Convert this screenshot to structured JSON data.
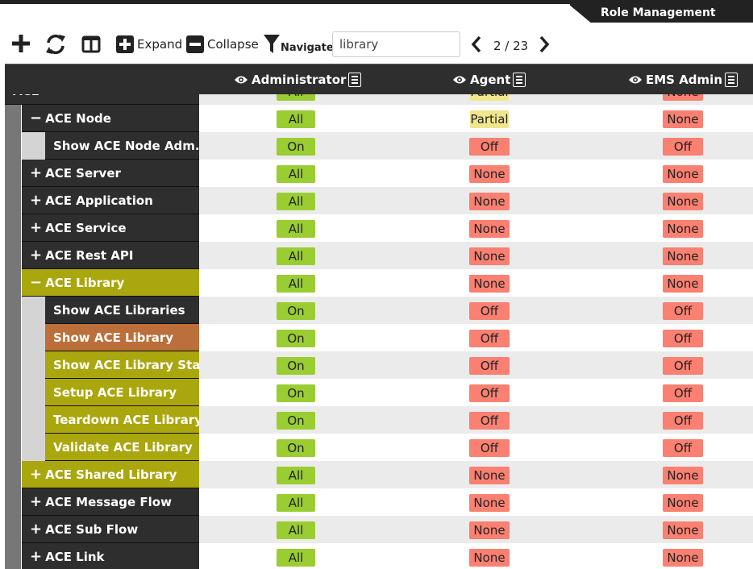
{
  "header": {
    "role_tab": "Role Management"
  },
  "toolbar": {
    "expand": "Expand",
    "collapse": "Collapse",
    "navigate": "Navigate",
    "search_value": "library",
    "page": "2 / 23"
  },
  "columns": [
    "Administrator",
    "Agent",
    "EMS Admin"
  ],
  "rows": [
    {
      "label": "ACE",
      "expander": "",
      "level": 0,
      "style": "dark",
      "values": [
        "All",
        "Partial",
        "None"
      ]
    },
    {
      "label": "ACE Node",
      "expander": "−",
      "level": 1,
      "style": "dark",
      "values": [
        "All",
        "Partial",
        "None"
      ]
    },
    {
      "label": "Show ACE Node Adm...",
      "expander": "",
      "level": 2,
      "style": "dark",
      "values": [
        "On",
        "Off",
        "Off"
      ]
    },
    {
      "label": "ACE Server",
      "expander": "+",
      "level": 1,
      "style": "dark",
      "values": [
        "All",
        "None",
        "None"
      ]
    },
    {
      "label": "ACE Application",
      "expander": "+",
      "level": 1,
      "style": "dark",
      "values": [
        "All",
        "None",
        "None"
      ]
    },
    {
      "label": "ACE Service",
      "expander": "+",
      "level": 1,
      "style": "dark",
      "values": [
        "All",
        "None",
        "None"
      ]
    },
    {
      "label": "ACE Rest API",
      "expander": "+",
      "level": 1,
      "style": "dark",
      "values": [
        "All",
        "None",
        "None"
      ]
    },
    {
      "label": "ACE Library",
      "expander": "−",
      "level": 1,
      "style": "olive",
      "values": [
        "All",
        "None",
        "None"
      ]
    },
    {
      "label": "Show ACE Libraries",
      "expander": "",
      "level": 2,
      "style": "dark",
      "values": [
        "On",
        "Off",
        "Off"
      ]
    },
    {
      "label": "Show ACE Library",
      "expander": "",
      "level": 2,
      "style": "orange",
      "values": [
        "On",
        "Off",
        "Off"
      ]
    },
    {
      "label": "Show ACE Library Sta...",
      "expander": "",
      "level": 2,
      "style": "olive",
      "values": [
        "On",
        "Off",
        "Off"
      ]
    },
    {
      "label": "Setup ACE Library",
      "expander": "",
      "level": 2,
      "style": "olive",
      "values": [
        "On",
        "Off",
        "Off"
      ]
    },
    {
      "label": "Teardown ACE Library",
      "expander": "",
      "level": 2,
      "style": "olive",
      "values": [
        "On",
        "Off",
        "Off"
      ]
    },
    {
      "label": "Validate ACE Library",
      "expander": "",
      "level": 2,
      "style": "olive",
      "values": [
        "On",
        "Off",
        "Off"
      ]
    },
    {
      "label": "ACE Shared Library",
      "expander": "+",
      "level": 1,
      "style": "olive",
      "values": [
        "All",
        "None",
        "None"
      ]
    },
    {
      "label": "ACE Message Flow",
      "expander": "+",
      "level": 1,
      "style": "dark",
      "values": [
        "All",
        "None",
        "None"
      ]
    },
    {
      "label": "ACE Sub Flow",
      "expander": "+",
      "level": 1,
      "style": "dark",
      "values": [
        "All",
        "None",
        "None"
      ]
    },
    {
      "label": "ACE Link",
      "expander": "+",
      "level": 1,
      "style": "dark",
      "values": [
        "All",
        "None",
        "None"
      ]
    }
  ],
  "colors": {
    "dark": "#2e2e2e",
    "olive": "#aaa60e",
    "orange": "#bc6f3a",
    "green": "#9acd32",
    "red": "#fa8072",
    "yellow": "#f0e68c",
    "row_alt": "#ebebeb"
  },
  "icons": [
    "plus-icon",
    "refresh-icon",
    "columns-icon",
    "expand-icon",
    "collapse-icon",
    "filter-icon",
    "chevron-left-icon",
    "chevron-right-icon",
    "eye-icon",
    "menu-icon"
  ]
}
